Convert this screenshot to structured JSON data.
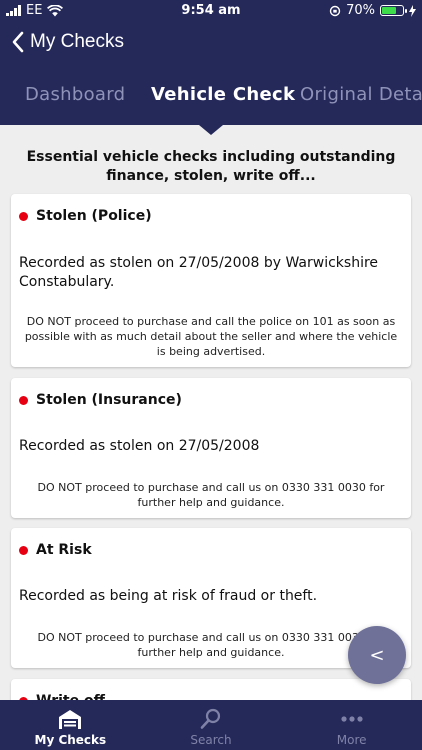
{
  "status_bar": {
    "carrier": "EE",
    "time": "9:54 am",
    "battery": "70%",
    "battery_level": 0.7,
    "icons": [
      "signal-icon",
      "wifi-icon",
      "orientation-lock-icon",
      "battery-icon",
      "charging-icon"
    ]
  },
  "header": {
    "back_label": "My Checks"
  },
  "tabs": [
    {
      "label": "Dashboard",
      "active": false
    },
    {
      "label": "Vehicle Check",
      "active": true
    },
    {
      "label": "Original Detai",
      "active": false
    }
  ],
  "intro": "Essential vehicle checks including outstanding finance, stolen, write off...",
  "cards": [
    {
      "title": "Stolen (Police)",
      "record": "Recorded as stolen  on 27/05/2008 by Warwickshire Constabulary.",
      "advice": "DO NOT proceed to purchase and call the police on 101 as soon as possible with as much detail about the seller and where the vehicle is being advertised."
    },
    {
      "title": "Stolen (Insurance)",
      "record": "Recorded as stolen on 27/05/2008",
      "advice": "DO NOT proceed to purchase and call us on 0330 331 0030 for further help and guidance."
    },
    {
      "title": "At Risk",
      "record": "Recorded as being at risk of fraud or theft.",
      "advice": "DO NOT proceed to purchase and call us on 0330 331 0030 for further help and guidance."
    },
    {
      "title": "Write off"
    }
  ],
  "fab_label": "<",
  "bottom_nav": [
    {
      "label": "My Checks",
      "icon": "garage-icon",
      "active": true
    },
    {
      "label": "Search",
      "icon": "search-icon",
      "active": false
    },
    {
      "label": "More",
      "icon": "more-dots-icon",
      "active": false
    }
  ],
  "colors": {
    "brand_navy": "#25295a",
    "alert_red": "#e60012",
    "background": "#eeeeee",
    "fab": "#6f7199"
  }
}
